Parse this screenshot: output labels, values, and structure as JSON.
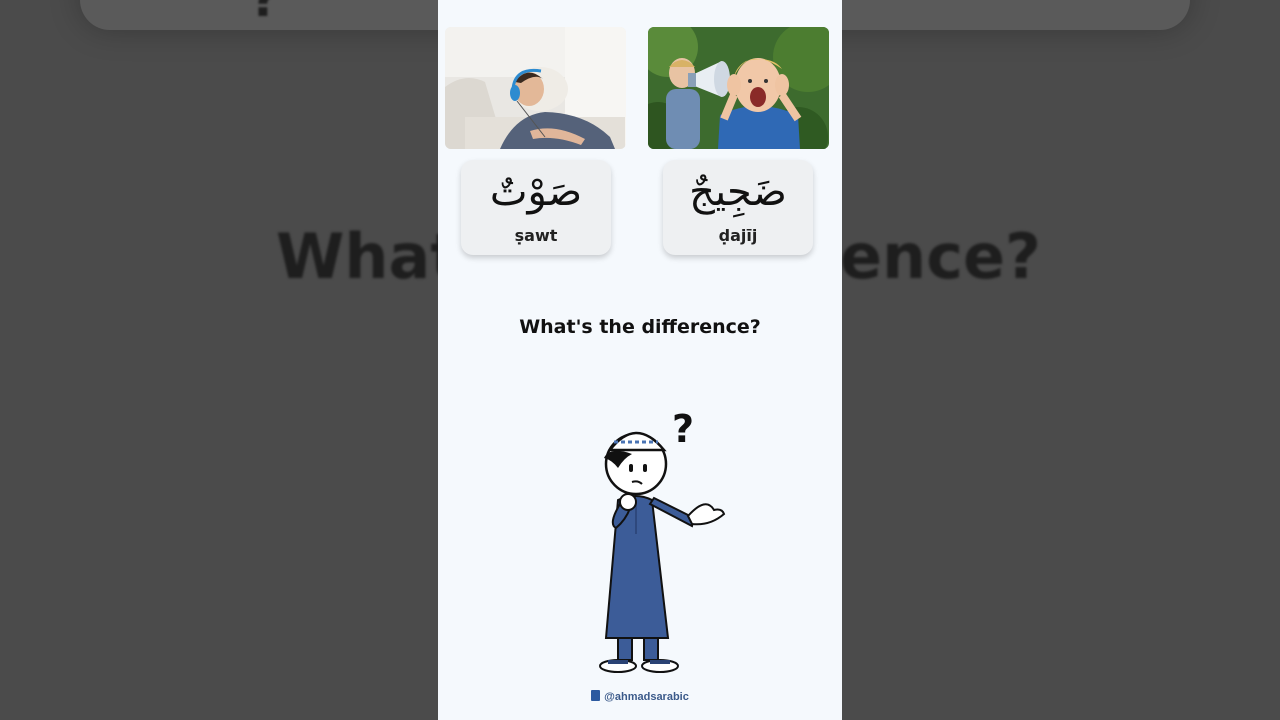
{
  "background": {
    "question_left": "What",
    "question_right": "ence?"
  },
  "cards": [
    {
      "arabic": "صَوْتٌ",
      "translit": "ṣawt"
    },
    {
      "arabic": "ضَجِيجٌ",
      "translit": "ḍajīj"
    }
  ],
  "question": "What's the difference?",
  "watermark": {
    "handle": "@ahmadsarabic",
    "icon": "book-icon"
  },
  "photos": {
    "left": "man-relaxing-with-headphones",
    "right": "boy-shouting-through-megaphone"
  }
}
